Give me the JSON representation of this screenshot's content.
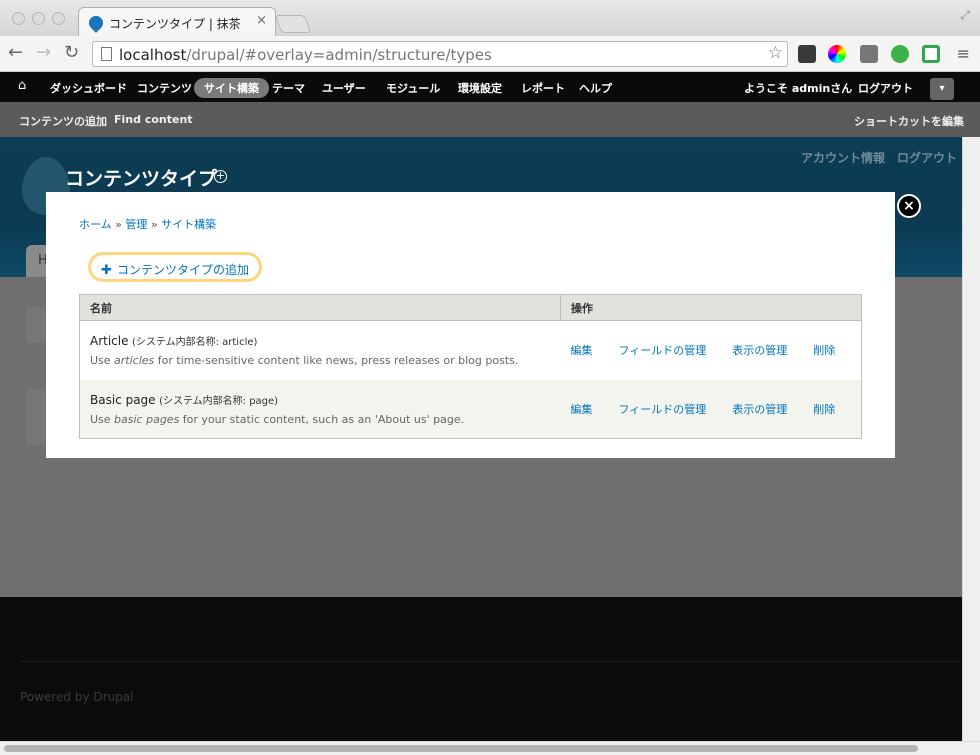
{
  "browser": {
    "tab_title": "コンテンツタイプ | 抹茶",
    "tab_close": "×",
    "url_host": "localhost",
    "url_path": "/drupal/#overlay=admin/structure/types",
    "back_icon": "←",
    "forward_icon": "→",
    "reload_icon": "↻",
    "star_icon": "☆",
    "menu_icon": "≡",
    "expand_icon": "⤢"
  },
  "admin_toolbar": {
    "home_icon": "⌂",
    "items": [
      "ダッシュボード",
      "コンテンツ",
      "サイト構築",
      "テーマ",
      "ユーザー",
      "モジュール",
      "環境設定",
      "レポート",
      "ヘルプ"
    ],
    "active_item": "サイト構築",
    "welcome": "ようこそ adminさん",
    "logout": "ログアウト",
    "toggle_icon": "▾"
  },
  "shortcut_bar": {
    "items": [
      "コンテンツの追加",
      "Find content"
    ],
    "edit_shortcuts": "ショートカットを編集"
  },
  "page": {
    "title": "コンテンツタイプ",
    "plus_icon": "+",
    "secondary": [
      "アカウント情報",
      "ログアウト"
    ],
    "home_tab": "H",
    "footer": "Powered by Drupal"
  },
  "overlay": {
    "close_icon": "×",
    "breadcrumb": [
      "ホーム",
      "管理",
      "サイト構築"
    ],
    "separator": "»",
    "add_link": "コンテンツタイプの追加",
    "add_icon": "✚",
    "table": {
      "headers": [
        "名前",
        "操作"
      ],
      "rows": [
        {
          "name": "Article",
          "machine": "(システム内部名称: article)",
          "desc_pre": "Use ",
          "desc_em": "articles",
          "desc_post": " for time-sensitive content like news, press releases or blog posts.",
          "ops": [
            "編集",
            "フィールドの管理",
            "表示の管理",
            "削除"
          ]
        },
        {
          "name": "Basic page",
          "machine": "(システム内部名称: page)",
          "desc_pre": "Use ",
          "desc_em": "basic pages",
          "desc_post": " for your static content, such as an 'About us' page.",
          "ops": [
            "編集",
            "フィールドの管理",
            "表示の管理",
            "削除"
          ]
        }
      ]
    }
  },
  "colors": {
    "link": "#0074bd",
    "add_link_border": "#fcd57d",
    "toolbar_bg": "#0a0a0a",
    "header_bg": "#0b3a52"
  }
}
